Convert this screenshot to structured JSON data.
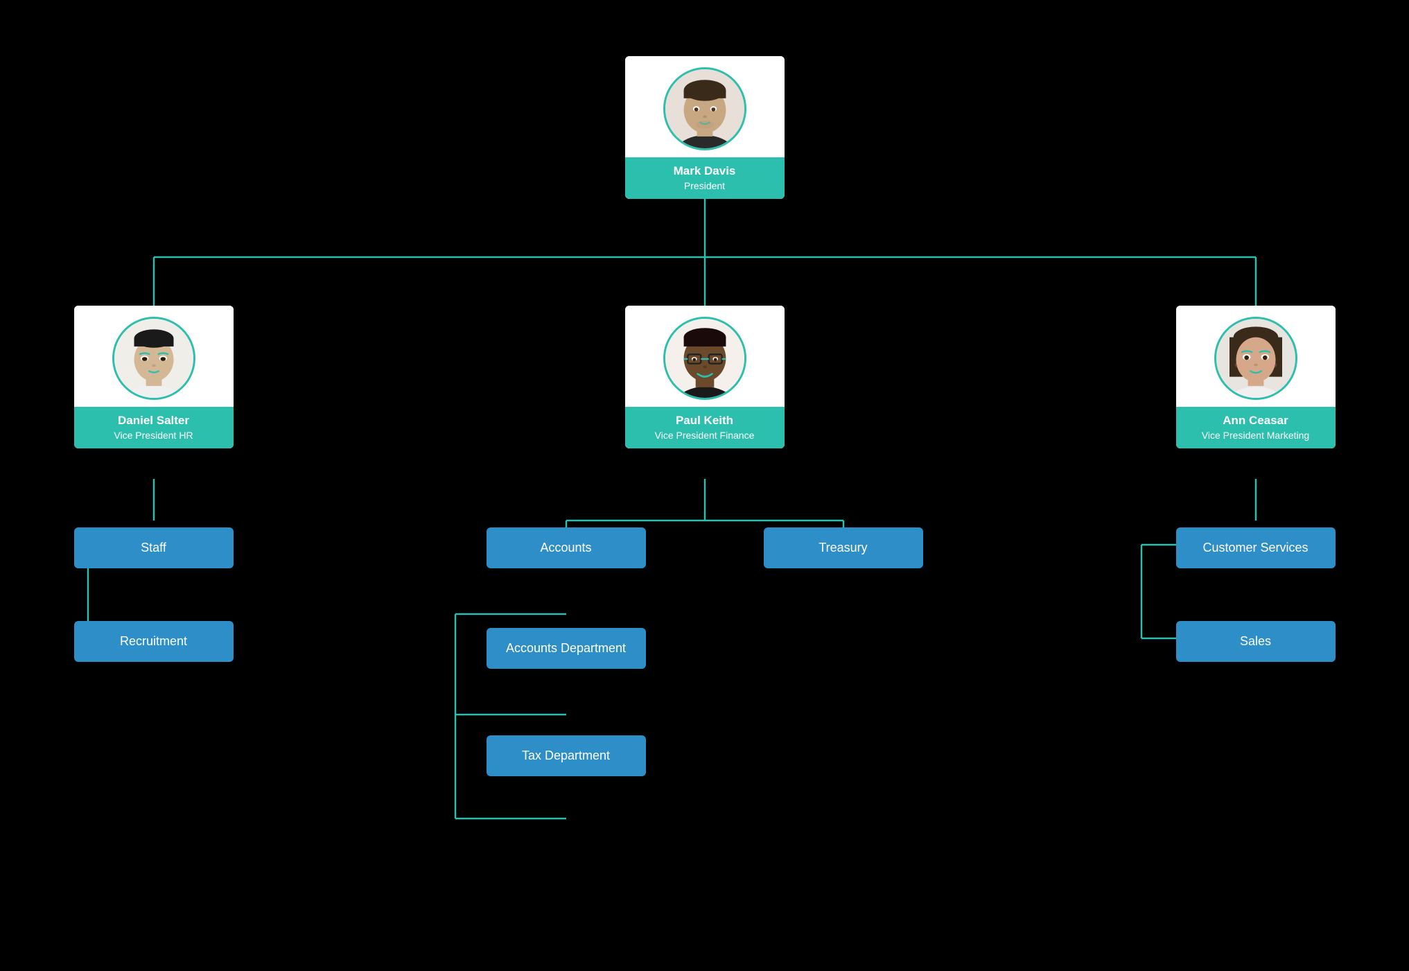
{
  "chart": {
    "background": "#000000",
    "accent_color": "#2dbfad",
    "dept_color": "#2e8ec8",
    "people": {
      "president": {
        "name": "Mark Davis",
        "title": "President",
        "avatar_style": "mark"
      },
      "vp_hr": {
        "name": "Daniel Salter",
        "title": "Vice President HR",
        "avatar_style": "daniel"
      },
      "vp_finance": {
        "name": "Paul Keith",
        "title": "Vice President Finance",
        "avatar_style": "paul"
      },
      "vp_marketing": {
        "name": "Ann Ceasar",
        "title": "Vice President Marketing",
        "avatar_style": "ann"
      }
    },
    "departments": {
      "hr": [
        "Staff",
        "Recruitment"
      ],
      "finance_main": [
        "Accounts",
        "Treasury"
      ],
      "finance_sub": [
        "Accounts Department",
        "Tax Department"
      ],
      "marketing": [
        "Customer Services",
        "Sales"
      ]
    }
  }
}
